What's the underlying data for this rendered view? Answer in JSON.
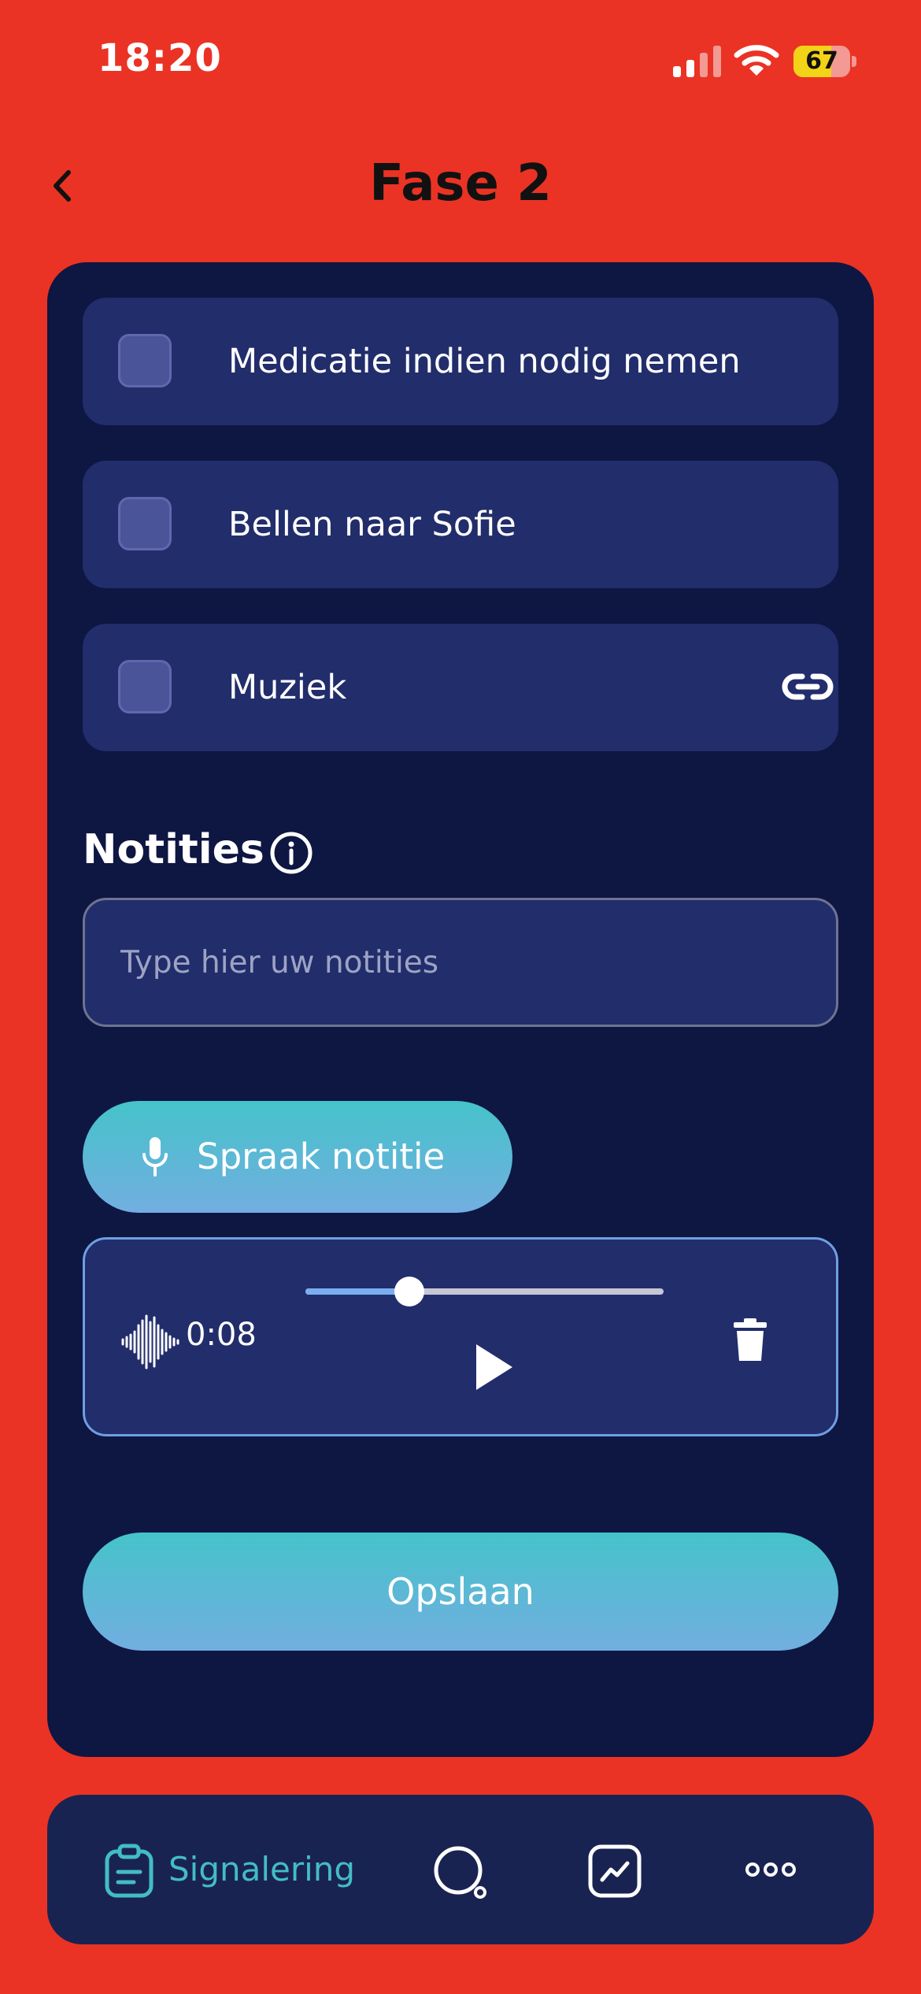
{
  "status_bar": {
    "time": "18:20",
    "battery": "67",
    "battery_level": 0.67
  },
  "header": {
    "title": "Fase 2",
    "back_icon": "chevron-left-icon"
  },
  "tasks": [
    {
      "label": "Medicatie indien nodig nemen",
      "checked": false,
      "has_link": false
    },
    {
      "label": "Bellen naar Sofie",
      "checked": false,
      "has_link": false
    },
    {
      "label": "Muziek",
      "checked": false,
      "has_link": true
    }
  ],
  "notes": {
    "title": "Notities",
    "placeholder": "Type hier uw notities",
    "value": ""
  },
  "voice_note": {
    "button_label": "Spraak notitie",
    "duration": "0:08",
    "progress": 0.29
  },
  "save": {
    "label": "Opslaan"
  },
  "bottom_nav": {
    "active_label": "Signalering",
    "items": [
      "clipboard-icon",
      "search-icon",
      "chart-icon",
      "more-icon"
    ]
  },
  "colors": {
    "background": "#ea3324",
    "card": "#0e1642",
    "task": "#222d6b",
    "accent": "#43bcc7",
    "gradient_start": "#45c3ca",
    "gradient_end": "#72aee0"
  }
}
